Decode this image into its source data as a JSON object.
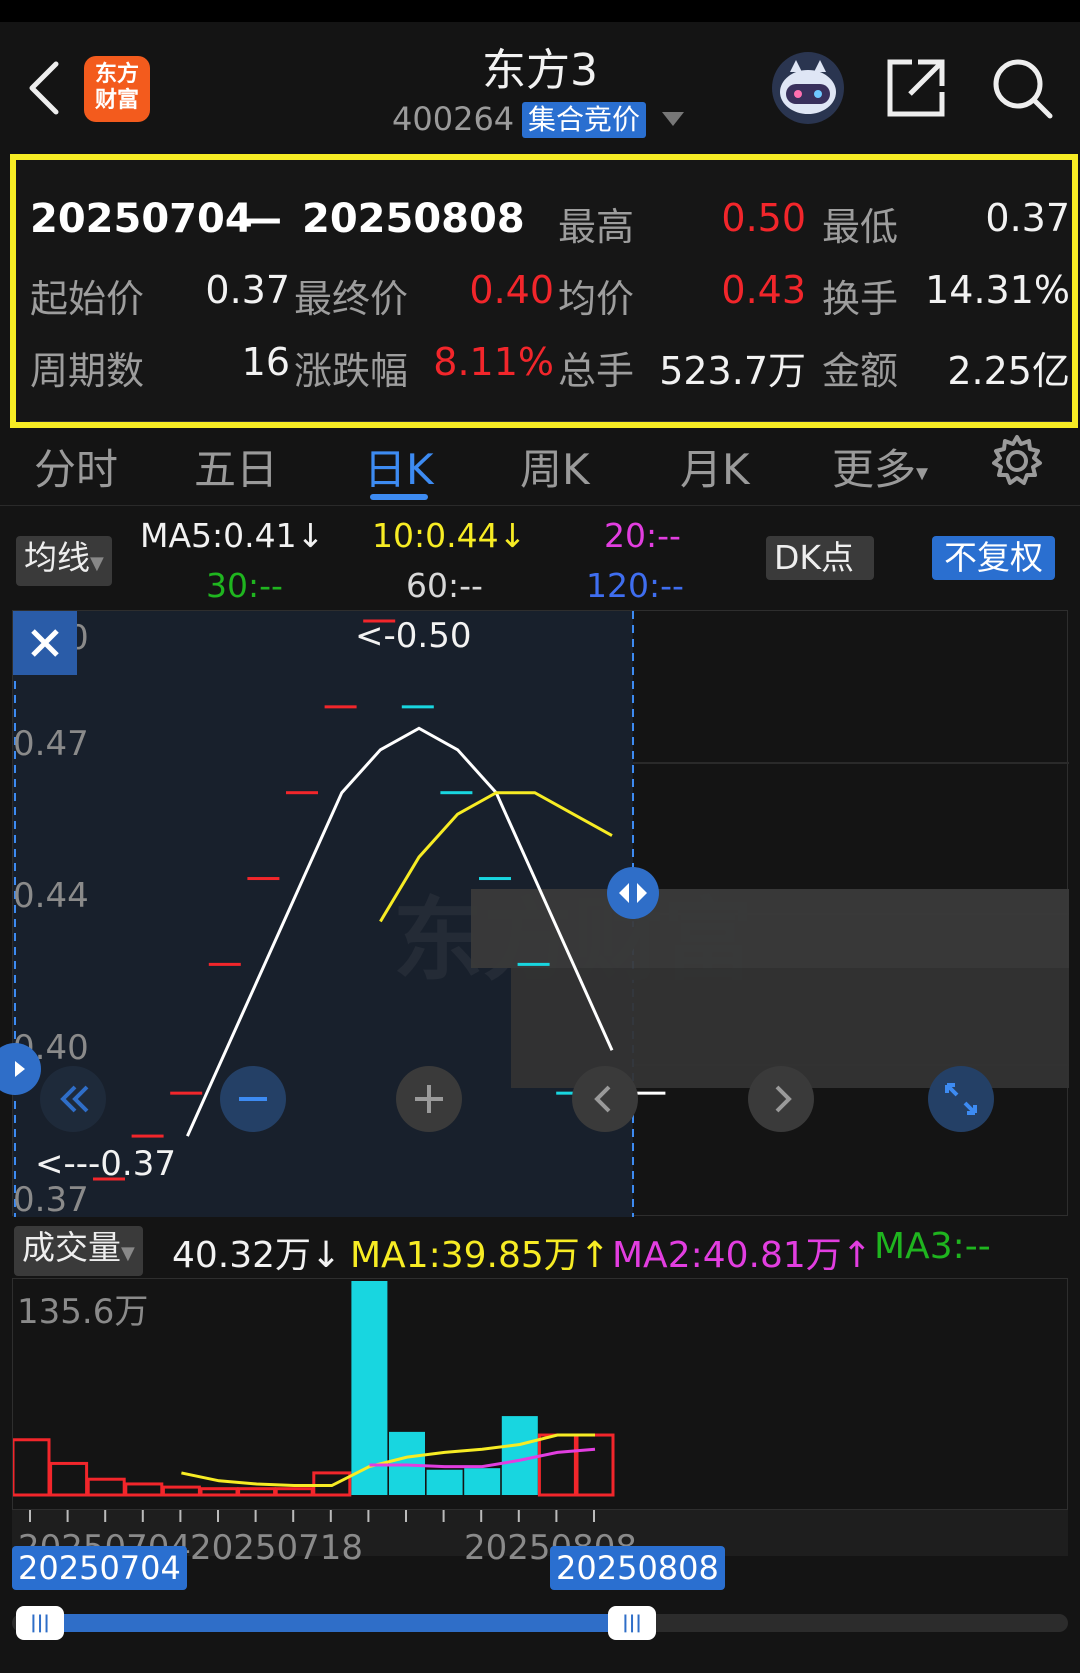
{
  "header": {
    "title": "东方3",
    "code": "400264",
    "badge": "集合竞价",
    "logo_line1": "东方",
    "logo_line2": "财富"
  },
  "summary": {
    "range_start": "20250704",
    "range_sep": "—",
    "range_end": "20250808",
    "high_label": "最高",
    "high_value": "0.50",
    "low_label": "最低",
    "low_value": "0.37",
    "open_label": "起始价",
    "open_value": "0.37",
    "close_label": "最终价",
    "close_value": "0.40",
    "avg_label": "均价",
    "avg_value": "0.43",
    "turnover_label": "换手",
    "turnover_value": "14.31%",
    "periods_label": "周期数",
    "periods_value": "16",
    "change_label": "涨跌幅",
    "change_value": "8.11%",
    "volume_label": "总手",
    "volume_value": "523.7万",
    "amount_label": "金额",
    "amount_value": "2.25亿"
  },
  "tabs": [
    "分时",
    "五日",
    "日K",
    "周K",
    "月K",
    "更多"
  ],
  "active_tab": "日K",
  "ma_bar": {
    "selector": "均线",
    "ma5": "MA5:0.41↓",
    "ma10": "10:0.44↓",
    "ma20": "20:--",
    "ma30": "30:--",
    "ma60": "60:--",
    "ma120": "120:--",
    "dk": "DK点",
    "adjust": "不复权"
  },
  "price_axis": [
    "0.50",
    "0.47",
    "0.44",
    "0.40",
    "0.37"
  ],
  "max_marker": "<-0.50",
  "min_marker": "<---0.37",
  "volume_bar": {
    "selector": "成交量",
    "vol": "40.32万↓",
    "ma1": "MA1:39.85万↑",
    "ma2": "MA2:40.81万↑",
    "ma3": "MA3:--",
    "max_label": "135.6万"
  },
  "date_axis": [
    "20250704",
    "20250718",
    "20250808"
  ],
  "range_tags": {
    "start": "20250704",
    "end": "20250808"
  },
  "colors": {
    "up": "#f2262b",
    "down": "#18d6e0",
    "ma5": "#ffffff",
    "ma10": "#f7ec24",
    "ma20": "#e23ee0",
    "ma30": "#1fb51f",
    "ma120": "#3f6ef0",
    "accent": "#3d8bf2"
  },
  "chart_data": {
    "type": "candlestick",
    "ylim": [
      0.37,
      0.5
    ],
    "days": [
      {
        "o": 0.37,
        "c": 0.37,
        "dir": "up"
      },
      {
        "o": 0.38,
        "c": 0.38,
        "dir": "up"
      },
      {
        "o": 0.39,
        "c": 0.39,
        "dir": "up"
      },
      {
        "o": 0.42,
        "c": 0.42,
        "dir": "up"
      },
      {
        "o": 0.44,
        "c": 0.44,
        "dir": "up"
      },
      {
        "o": 0.46,
        "c": 0.46,
        "dir": "up"
      },
      {
        "o": 0.48,
        "c": 0.48,
        "dir": "up"
      },
      {
        "o": 0.5,
        "c": 0.5,
        "dir": "up"
      },
      {
        "o": 0.48,
        "c": 0.48,
        "dir": "down"
      },
      {
        "o": 0.46,
        "c": 0.46,
        "dir": "down"
      },
      {
        "o": 0.44,
        "c": 0.44,
        "dir": "down"
      },
      {
        "o": 0.42,
        "c": 0.42,
        "dir": "down"
      },
      {
        "o": 0.39,
        "c": 0.39,
        "dir": "down"
      },
      {
        "o": 0.39,
        "c": 0.39,
        "dir": "flat"
      },
      {
        "o": 0.39,
        "c": 0.39,
        "dir": "flat"
      }
    ],
    "ma5": [
      null,
      null,
      null,
      null,
      0.38,
      0.4,
      0.42,
      0.44,
      0.46,
      0.47,
      0.475,
      0.47,
      0.46,
      0.44,
      0.42,
      0.4
    ],
    "ma10": [
      null,
      null,
      null,
      null,
      null,
      null,
      null,
      null,
      null,
      0.43,
      0.445,
      0.455,
      0.46,
      0.46,
      0.455,
      0.45
    ],
    "volume": {
      "max_label": "135.6万",
      "values": [
        35,
        20,
        10,
        7,
        5,
        4,
        4,
        4,
        14,
        135.6,
        40,
        16,
        17,
        50,
        38,
        38
      ],
      "dirs": [
        "up",
        "up",
        "up",
        "up",
        "up",
        "up",
        "up",
        "up",
        "up",
        "down",
        "down",
        "down",
        "down",
        "down",
        "up",
        "up"
      ],
      "ma1": [
        null,
        null,
        null,
        null,
        14,
        9,
        7,
        6,
        6,
        18,
        24,
        27,
        29,
        32,
        38,
        38
      ],
      "ma2": [
        null,
        null,
        null,
        null,
        null,
        null,
        null,
        null,
        null,
        19,
        19,
        18,
        18,
        22,
        27,
        29
      ]
    }
  }
}
